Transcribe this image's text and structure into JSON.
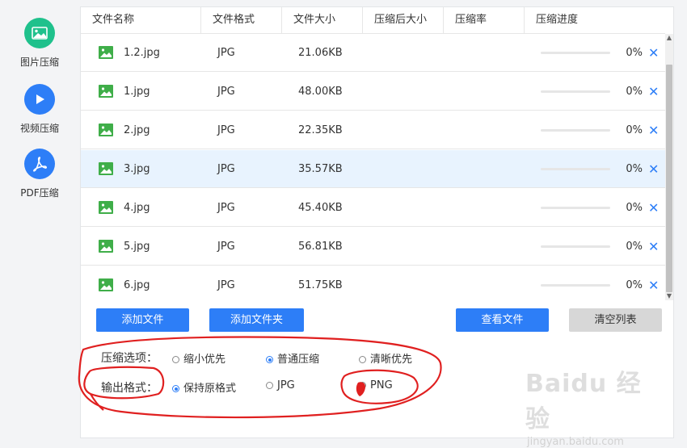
{
  "sidebar": {
    "items": [
      {
        "label": "图片压缩",
        "icon": "image-icon",
        "color": "#1fc18c"
      },
      {
        "label": "视频压缩",
        "icon": "play-icon",
        "color": "#2d7ef7"
      },
      {
        "label": "PDF压缩",
        "icon": "pdf-icon",
        "color": "#2d7ef7"
      }
    ]
  },
  "table": {
    "columns": [
      "文件名称",
      "文件格式",
      "文件大小",
      "压缩后大小",
      "压缩率",
      "压缩进度"
    ],
    "rows": [
      {
        "name": "1.2.jpg",
        "format": "JPG",
        "size": "21.06KB",
        "compressed": "",
        "ratio": "",
        "progress": 0,
        "percent": "0%"
      },
      {
        "name": "1.jpg",
        "format": "JPG",
        "size": "48.00KB",
        "compressed": "",
        "ratio": "",
        "progress": 0,
        "percent": "0%"
      },
      {
        "name": "2.jpg",
        "format": "JPG",
        "size": "22.35KB",
        "compressed": "",
        "ratio": "",
        "progress": 0,
        "percent": "0%"
      },
      {
        "name": "3.jpg",
        "format": "JPG",
        "size": "35.57KB",
        "compressed": "",
        "ratio": "",
        "progress": 0,
        "percent": "0%",
        "selected": true
      },
      {
        "name": "4.jpg",
        "format": "JPG",
        "size": "45.40KB",
        "compressed": "",
        "ratio": "",
        "progress": 0,
        "percent": "0%"
      },
      {
        "name": "5.jpg",
        "format": "JPG",
        "size": "56.81KB",
        "compressed": "",
        "ratio": "",
        "progress": 0,
        "percent": "0%"
      },
      {
        "name": "6.jpg",
        "format": "JPG",
        "size": "51.75KB",
        "compressed": "",
        "ratio": "",
        "progress": 0,
        "percent": "0%"
      }
    ],
    "remove_icon": "close-icon"
  },
  "buttons": {
    "add_file": "添加文件",
    "add_folder": "添加文件夹",
    "view_files": "查看文件",
    "clear_list": "清空列表"
  },
  "options": {
    "compress_label": "压缩选项：",
    "compress_choices": [
      "缩小优先",
      "普通压缩",
      "清晰优先"
    ],
    "compress_selected": "普通压缩",
    "format_label": "输出格式：",
    "format_choices": [
      "保持原格式",
      "JPG",
      "PNG"
    ],
    "format_selected": "保持原格式"
  },
  "watermark": {
    "main": "Baidu 经验",
    "sub": "jingyan.baidu.com"
  },
  "colors": {
    "accent": "#2d7ef7",
    "selected_row": "#e8f3fe",
    "annotation": "#e02020"
  }
}
